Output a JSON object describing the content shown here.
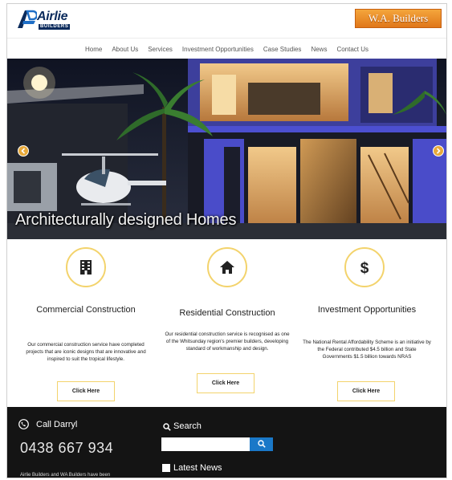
{
  "header": {
    "logo_name": "Airlie",
    "logo_sub": "BUILDERS",
    "wa_button": "W.A. Builders"
  },
  "nav": {
    "items": [
      "Home",
      "About Us",
      "Services",
      "Investment Opportunities",
      "Case Studies",
      "News",
      "Contact Us"
    ]
  },
  "hero": {
    "caption": "Architecturally designed Homes"
  },
  "services": [
    {
      "icon": "building-icon",
      "title": "Commercial Construction",
      "text": "Our commercial construction service have completed projects that are iconic designs that are innovative and inspired to suit the tropical lifestyle.",
      "button": "Click Here"
    },
    {
      "icon": "home-icon",
      "title": "Residential Construction",
      "text": "Our residential construction service is recognised as one of the Whitsunday region's premier builders, developing standard of workmanship and design.",
      "button": "Click Here"
    },
    {
      "icon": "dollar-icon",
      "title": "Investment Opportunities",
      "text": "The National Rental Affordability Scheme is an initiative by the Federal contributed $4.5 billion and State Governments $1.5 billion towards NRAS",
      "button": "Click Here"
    }
  ],
  "footer": {
    "call_label": "Call Darryl",
    "phone": "0438 667 934",
    "text": "Airlie Builders and WA Builders have been",
    "search_label": "Search",
    "search_value": "",
    "news_label": "Latest News"
  },
  "colors": {
    "accent_gold": "#f3d36c",
    "button_orange": "#e0771a",
    "search_blue": "#1a78c8",
    "footer_bg": "#141414"
  }
}
